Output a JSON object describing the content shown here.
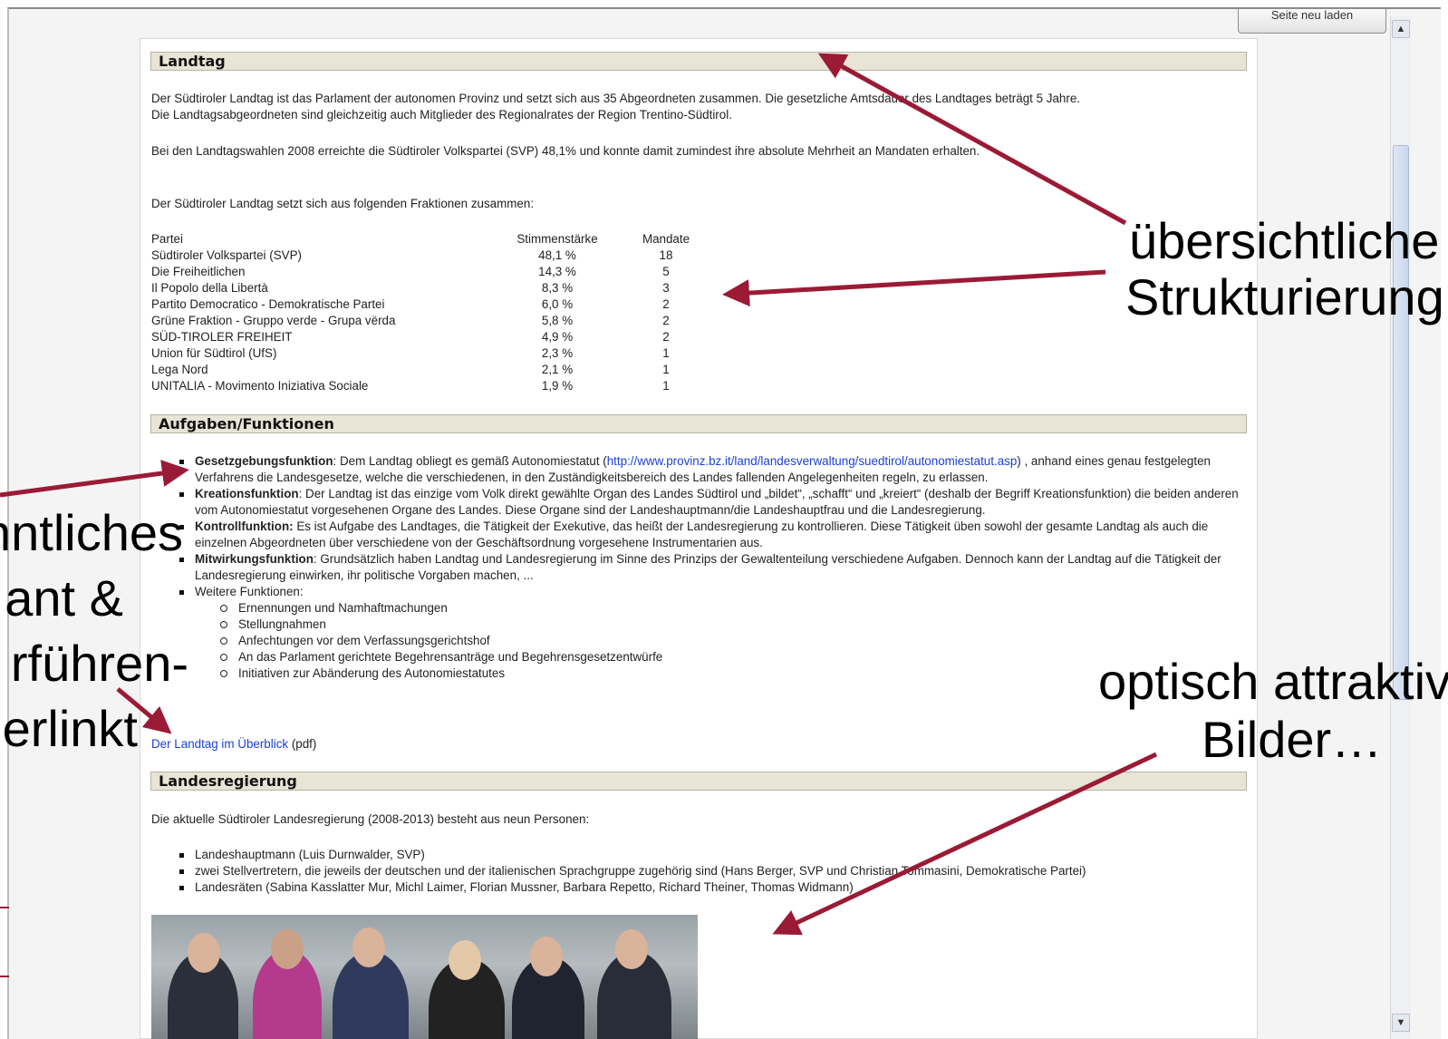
{
  "browser": {
    "reload_label": "Seite neu laden"
  },
  "landtag": {
    "heading": "Landtag",
    "intro_line1": "Der Südtiroler Landtag ist das Parlament der autonomen Provinz und setzt sich aus 35 Abgeordneten zusammen. Die gesetzliche Amtsdauer des Landtages beträgt 5 Jahre.",
    "intro_line2": "Die Landtagsabgeordneten sind gleichzeitig auch Mitglieder des Regionalrates der Region Trentino-Südtirol.",
    "election": "Bei den Landtagswahlen 2008 erreichte die Südtiroler Volkspartei (SVP) 48,1% und konnte damit zumindest ihre absolute Mehrheit an Mandaten erhalten.",
    "factions_intro": "Der Südtiroler Landtag setzt sich aus folgenden Fraktionen zusammen:",
    "table": {
      "headers": [
        "Partei",
        "Stimmenstärke",
        "Mandate"
      ],
      "rows": [
        [
          "Südtiroler Volkspartei (SVP)",
          "48,1 %",
          "18"
        ],
        [
          "Die Freiheitlichen",
          "14,3 %",
          "5"
        ],
        [
          "Il Popolo della Libertà",
          "8,3 %",
          "3"
        ],
        [
          "Partito Democratico - Demokratische Partei",
          "6,0 %",
          "2"
        ],
        [
          "Grüne Fraktion - Gruppo verde - Grupa vërda",
          "5,8 %",
          "2"
        ],
        [
          "SÜD-TIROLER FREIHEIT",
          "4,9 %",
          "2"
        ],
        [
          "Union für Südtirol (UfS)",
          "2,3 %",
          "1"
        ],
        [
          "Lega Nord",
          "2,1 %",
          "1"
        ],
        [
          "UNITALIA - Movimento Iniziativa Sociale",
          "1,9 %",
          "1"
        ]
      ]
    }
  },
  "aufgaben": {
    "heading": "Aufgaben/Funktionen",
    "items": [
      {
        "term": "Gesetzgebungsfunktion",
        "text_before": ": Dem Landtag obliegt es gemäß Autonomiestatut (",
        "link": "http://www.provinz.bz.it/land/landesverwaltung/suedtirol/autonomiestatut.asp",
        "text_after": ") , anhand eines genau festgelegten Verfahrens die Landesgesetze, welche die verschiedenen, in den Zuständigkeitsbereich des Landes fallenden Angelegenheiten regeln, zu erlassen."
      },
      {
        "term": "Kreationsfunktion",
        "text": ": Der Landtag ist das einzige vom Volk direkt gewählte Organ des Landes Südtirol und „bildet“, „schafft“ und „kreiert“ (deshalb der Begriff Kreationsfunktion) die beiden anderen vom Autonomiestatut vorgesehenen Organe des Landes. Diese Organe sind der Landeshauptmann/die Landeshauptfrau und die Landesregierung."
      },
      {
        "term": "Kontrollfunktion:",
        "text": " Es ist Aufgabe des Landtages, die Tätigkeit der Exekutive, das heißt der Landesregierung zu kontrollieren. Diese Tätigkeit üben sowohl der gesamte Landtag als auch die einzelnen Abgeordneten über verschiedene von der Geschäftsordnung vorgesehene Instrumentarien aus."
      },
      {
        "term": "Mitwirkungsfunktion",
        "text": ": Grundsätzlich haben Landtag und Landesregierung im Sinne des Prinzips der Gewaltenteilung verschiedene Aufgaben. Dennoch kann der Landtag auf die Tätigkeit der Landesregierung einwirken, ihr politische Vorgaben machen, ..."
      }
    ],
    "weitere_label": "Weitere Funktionen:",
    "weitere": [
      "Ernennungen und Namhaftmachungen",
      "Stellungnahmen",
      "Anfechtungen vor dem Verfassungsgerichtshof",
      "An das Parlament gerichtete Begehrensanträge und Begehrensgesetzentwürfe",
      "Initiativen zur Abänderung des Autonomiestatutes"
    ],
    "pdf_link": "Der Landtag im Überblick",
    "pdf_suffix": " (pdf)"
  },
  "regierung": {
    "heading": "Landesregierung",
    "intro": "Die aktuelle Südtiroler Landesregierung (2008-2013) besteht aus neun Personen:",
    "items": [
      "Landeshauptmann (Luis Durnwalder, SVP)",
      "zwei Stellvertretern, die jeweils der deutschen und der italienischen Sprachgruppe zugehörig sind (Hans Berger, SVP und Christian Tommasini, Demokratische Partei)",
      "Landesräten (Sabina Kasslatter Mur, Michl Laimer, Florian Mussner, Barbara Repetto, Richard Theiner, Thomas Widmann)"
    ]
  },
  "annotations": {
    "right_top_line1": "übersichtliche",
    "right_top_line2": "Strukturierung",
    "right_bottom_line1": "optisch attraktive",
    "right_bottom_line2": "Bilder…",
    "left_line1": "nntliches",
    "left_line2": "ant &",
    "left_line3": "rführen-",
    "left_line4": "erlinkt",
    "arrow_color": "#9b1a36"
  }
}
